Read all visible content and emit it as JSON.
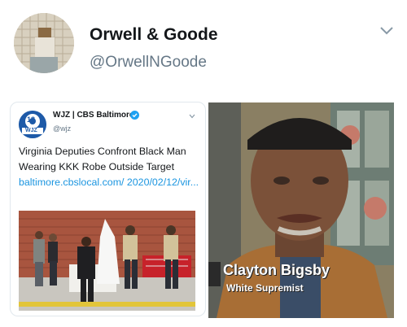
{
  "header": {
    "display_name": "Orwell & Goode",
    "handle": "@OrwellNGoode"
  },
  "embedded_tweet": {
    "logo_text": "13",
    "logo_sub": "WJZ",
    "account_name": "WJZ | CBS Baltimore",
    "handle": "@wjz",
    "headline": "Virginia Deputies Confront Black Man Wearing KKK Robe Outside Target ",
    "link": "baltimore.cbslocal.com/ 2020/02/12/vir...",
    "accent_color": "#1b95e0"
  },
  "tv_caption": {
    "name": "Clayton Bigsby",
    "title": "White Supremist"
  },
  "icons": {
    "chevron": "chevron-down-icon",
    "verified": "verified-badge-icon"
  }
}
